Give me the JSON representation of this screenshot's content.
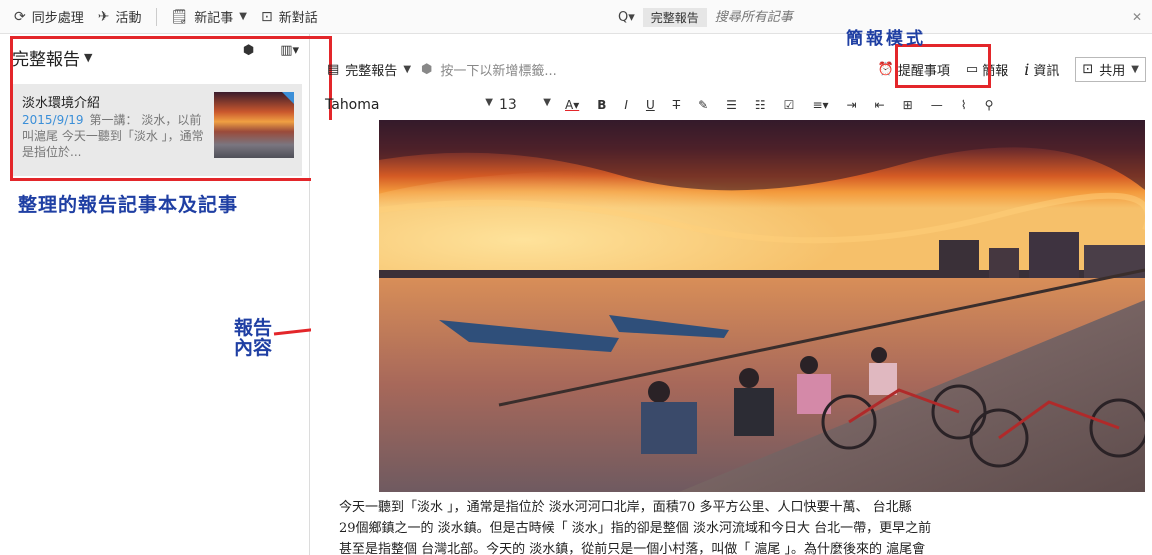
{
  "toolbar": {
    "sync_label": "同步處理",
    "activity_label": "活動",
    "new_note_label": "新記事",
    "new_chat_label": "新對話"
  },
  "search": {
    "notebook_label": "完整報告",
    "placeholder": "搜尋所有記事"
  },
  "notebook": {
    "title": "完整報告",
    "notes": [
      {
        "title": "淡水環境介紹",
        "date": "2015/9/19",
        "snippet": "第一講： 淡水，以前叫滬尾 今天一聽到「淡水 」，通常是指位於..."
      }
    ]
  },
  "note_header": {
    "notebook": "完整報告",
    "tag_placeholder": "按一下以新增標籤...",
    "reminder_label": "提醒事項",
    "presentation_label": "簡報",
    "info_label": "資訊",
    "share_label": "共用"
  },
  "format": {
    "font": "Tahoma",
    "size": "13"
  },
  "annotations": {
    "left_note": "整理的報告記事本及記事",
    "content_note": "報告內容",
    "presentation_note": "簡報模式"
  },
  "body": {
    "lines": [
      "今天一聽到「淡水 」，通常是指位於 淡水河河口北岸，面積70 多平方公里、人口快要十萬、 台北縣",
      "29個鄉鎮之一的 淡水鎮。但是古時候「 淡水」指的卻是整個 淡水河流域和今日大 台北一帶，更早之前",
      "甚至是指整個 台灣北部。今天的 淡水鎮，從前只是一個小村落，叫做「 滬尾 」。為什麼後來的 滬尾會"
    ]
  },
  "colors": {
    "accent": "#3b8fd8",
    "annotation": "#1f3fa3",
    "highlight_box": "#e3262a"
  }
}
